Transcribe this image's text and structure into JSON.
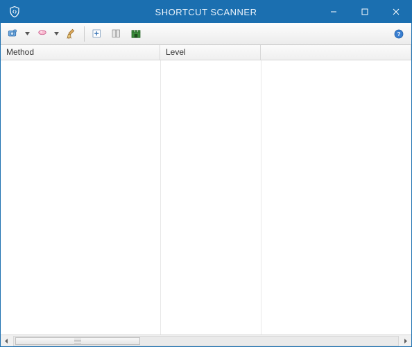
{
  "title": "SHORTCUT SCANNER",
  "toolbar": {
    "scan_label": "Scan",
    "clean_label": "Clean",
    "sweep_label": "Sweep",
    "add_label": "Add",
    "columns_label": "Columns",
    "report_label": "Report",
    "help_label": "Help"
  },
  "columns": [
    {
      "label": "Method"
    },
    {
      "label": "Level"
    },
    {
      "label": ""
    }
  ],
  "rows": []
}
